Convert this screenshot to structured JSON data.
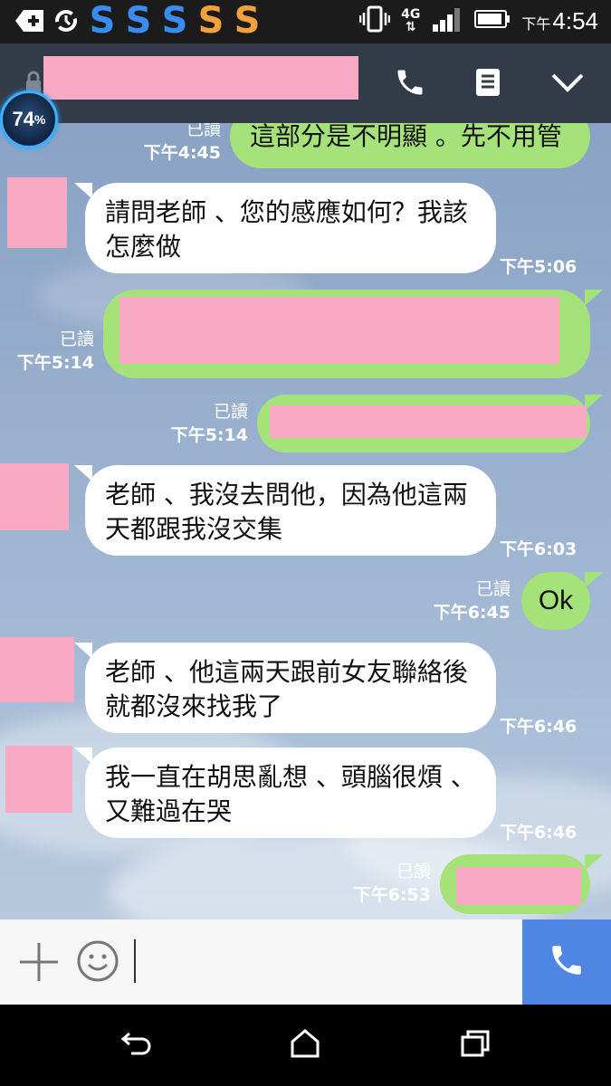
{
  "status_bar": {
    "time_prefix": "下午",
    "time": "4:54",
    "network": "4G",
    "s_icon_colors": [
      "#3a8df0",
      "#3a8df0",
      "#3a8df0",
      "#f2a03a",
      "#f2a03a"
    ]
  },
  "header": {
    "contact_name": "",
    "icons": [
      "phone-icon",
      "notes-icon",
      "chevron-down-icon"
    ]
  },
  "battery_badge": {
    "value": "74",
    "unit": "%"
  },
  "messages": [
    {
      "dir": "out",
      "text": "這部分是不明顯 。先不用管",
      "read": "已讀",
      "time": "下午4:45"
    },
    {
      "dir": "in",
      "text": "請問老師 、您的感應如何？我該怎麼做",
      "time": "下午5:06"
    },
    {
      "dir": "out",
      "text": "",
      "read": "已讀",
      "time": "下午5:14"
    },
    {
      "dir": "out",
      "text": "",
      "read": "已讀",
      "time": "下午5:14"
    },
    {
      "dir": "in",
      "text": "老師 、我沒去問他，因為他這兩天都跟我沒交集",
      "time": "下午6:03"
    },
    {
      "dir": "out",
      "text": "Ok",
      "read": "已讀",
      "time": "下午6:45"
    },
    {
      "dir": "in",
      "text": "老師 、他這兩天跟前女友聯絡後就都沒來找我了",
      "time": "下午6:46"
    },
    {
      "dir": "in",
      "text": "我一直在胡思亂想 、頭腦很煩 、又難過在哭",
      "time": "下午6:46"
    },
    {
      "dir": "out",
      "text": "",
      "read": "已讀",
      "time": "下午6:53"
    }
  ],
  "input": {
    "value": "",
    "placeholder": ""
  },
  "colors": {
    "header_bg": "#333b48",
    "outgoing_bubble": "#a6e27a",
    "incoming_bubble": "#ffffff",
    "call_button": "#4f86e3",
    "redaction": "#f8aac4"
  }
}
